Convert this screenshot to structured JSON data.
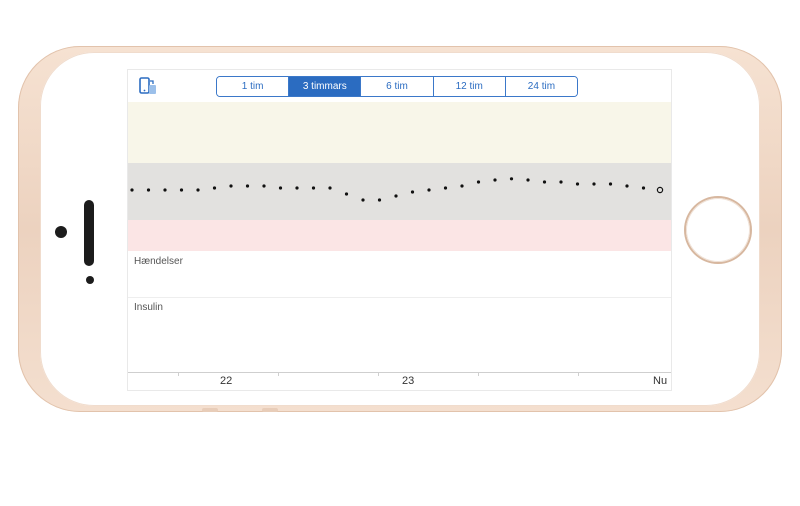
{
  "toolbar": {
    "device_icon": "phone-with-arrow-icon",
    "ranges": [
      "1 tim",
      "3 timmars",
      "6 tim",
      "12 tim",
      "24 tim"
    ],
    "selected_range": "3 timmars"
  },
  "sections": {
    "events_label": "Hændelser",
    "insulin_label": "Insulin"
  },
  "time_axis": {
    "labels": [
      "22",
      "23",
      "Nu"
    ]
  },
  "glucose_trace": {
    "relative_levels": [
      0.0,
      0.0,
      0.0,
      0.0,
      0.0,
      0.05,
      0.1,
      0.1,
      0.1,
      0.05,
      0.05,
      0.05,
      0.05,
      -0.1,
      -0.25,
      -0.25,
      -0.15,
      -0.05,
      0.0,
      0.05,
      0.1,
      0.2,
      0.25,
      0.28,
      0.25,
      0.2,
      0.2,
      0.15,
      0.15,
      0.15,
      0.1,
      0.05,
      0.0
    ],
    "last_point_hollow": true
  },
  "colors": {
    "accent": "#2b6cc1",
    "high_band": "#f8f6e9",
    "target_band": "#e2e1df",
    "low_band": "#fbe5e5"
  }
}
